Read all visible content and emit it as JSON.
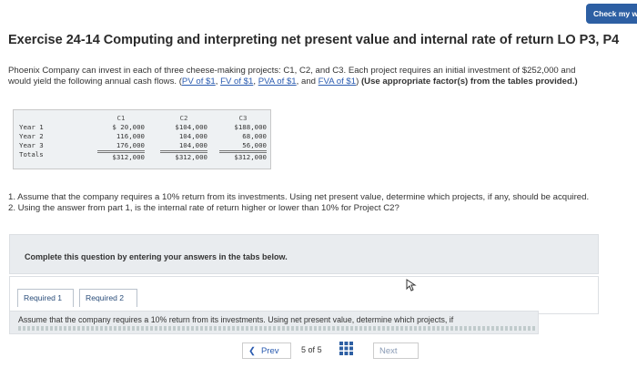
{
  "header": {
    "check_label": "Check my w"
  },
  "exercise": {
    "title": "Exercise 24-14 Computing and interpreting net present value and internal rate of return LO P3, P4"
  },
  "intro": {
    "text_a": "Phoenix Company can invest in each of three cheese-making projects: C1, C2, and C3. Each project requires an initial investment of $252,000 and would yield the following annual cash flows. (",
    "link_pv": "PV of $1",
    "sep1": ", ",
    "link_fv": "FV of $1",
    "sep2": ", ",
    "link_pva": "PVA of $1",
    "sep3": ", and ",
    "link_fva": "FVA of $1",
    "text_b": ") ",
    "bold": "(Use appropriate factor(s) from the tables provided.)"
  },
  "cash_flows": {
    "row_labels": [
      "Year 1",
      "Year 2",
      "Year 3",
      "Totals"
    ],
    "columns": [
      {
        "header": "C1",
        "values": [
          "$ 20,000",
          "116,000",
          "176,000"
        ],
        "total": "$312,000"
      },
      {
        "header": "C2",
        "values": [
          "$104,000",
          "104,000",
          "104,000"
        ],
        "total": "$312,000"
      },
      {
        "header": "C3",
        "values": [
          "$188,000",
          "68,000",
          "56,000"
        ],
        "total": "$312,000"
      }
    ]
  },
  "questions": {
    "q1": "1. Assume that the company requires a 10% return from its investments. Using net present value, determine which projects, if any, should be acquired.",
    "q2": "2. Using the answer from part 1, is the internal rate of return higher or lower than 10% for Project C2?"
  },
  "instruction": "Complete this question by entering your answers in the tabs below.",
  "tabs": [
    {
      "label": "Required 1"
    },
    {
      "label": "Required 2"
    }
  ],
  "answer_panel": {
    "text": "Assume that the company requires a 10% return from its investments. Using net present value, determine which projects, if"
  },
  "navigation": {
    "prev_label": "Prev",
    "page_current": "5",
    "page_of": "of",
    "page_total": "5",
    "next_label": "Next"
  },
  "colors": {
    "accent": "#2d5fa3",
    "link": "#2a5bb0",
    "panel": "#e9ecef"
  }
}
